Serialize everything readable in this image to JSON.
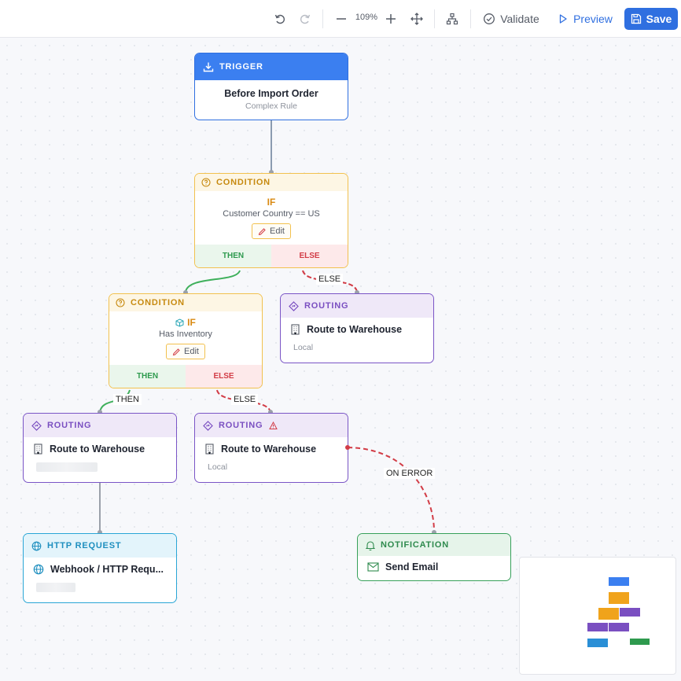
{
  "toolbar": {
    "zoom": "109%",
    "validate_label": "Validate",
    "preview_label": "Preview",
    "save_label": "Save"
  },
  "colors": {
    "accent": "#2f6fe0",
    "trigger": "#3b7ff0",
    "condition": "#f2c14e",
    "routing": "#7a55c6",
    "http": "#2aa6d6",
    "notification": "#37a05a",
    "error": "#d23c46"
  },
  "nodes": {
    "trigger": {
      "type_label": "TRIGGER",
      "title": "Before Import Order",
      "subtitle": "Complex Rule",
      "icon": "download-icon"
    },
    "condition1": {
      "type_label": "CONDITION",
      "if_label": "IF",
      "expression": "Customer Country == US",
      "edit_label": "Edit",
      "then_label": "THEN",
      "else_label": "ELSE",
      "icon": "question-circle-icon"
    },
    "routing_local_1": {
      "type_label": "ROUTING",
      "title": "Route to Warehouse",
      "subtitle": "Local",
      "icon": "route-diamond-icon"
    },
    "condition2": {
      "type_label": "CONDITION",
      "if_label": "IF",
      "expression": "Has Inventory",
      "edit_label": "Edit",
      "then_label": "THEN",
      "else_label": "ELSE",
      "icon": "question-circle-icon"
    },
    "routing_then": {
      "type_label": "ROUTING",
      "title": "Route to Warehouse",
      "icon": "route-diamond-icon"
    },
    "routing_else": {
      "type_label": "ROUTING",
      "title": "Route to Warehouse",
      "subtitle": "Local",
      "icon": "route-diamond-icon",
      "warning_icon": "warning-triangle-icon"
    },
    "http": {
      "type_label": "HTTP REQUEST",
      "title": "Webhook / HTTP Requ...",
      "icon": "globe-icon"
    },
    "notification": {
      "type_label": "NOTIFICATION",
      "title": "Send Email",
      "icon": "bell-icon"
    }
  },
  "edges": {
    "else1": "ELSE",
    "then2": "THEN",
    "else2": "ELSE",
    "on_error": "ON ERROR"
  }
}
